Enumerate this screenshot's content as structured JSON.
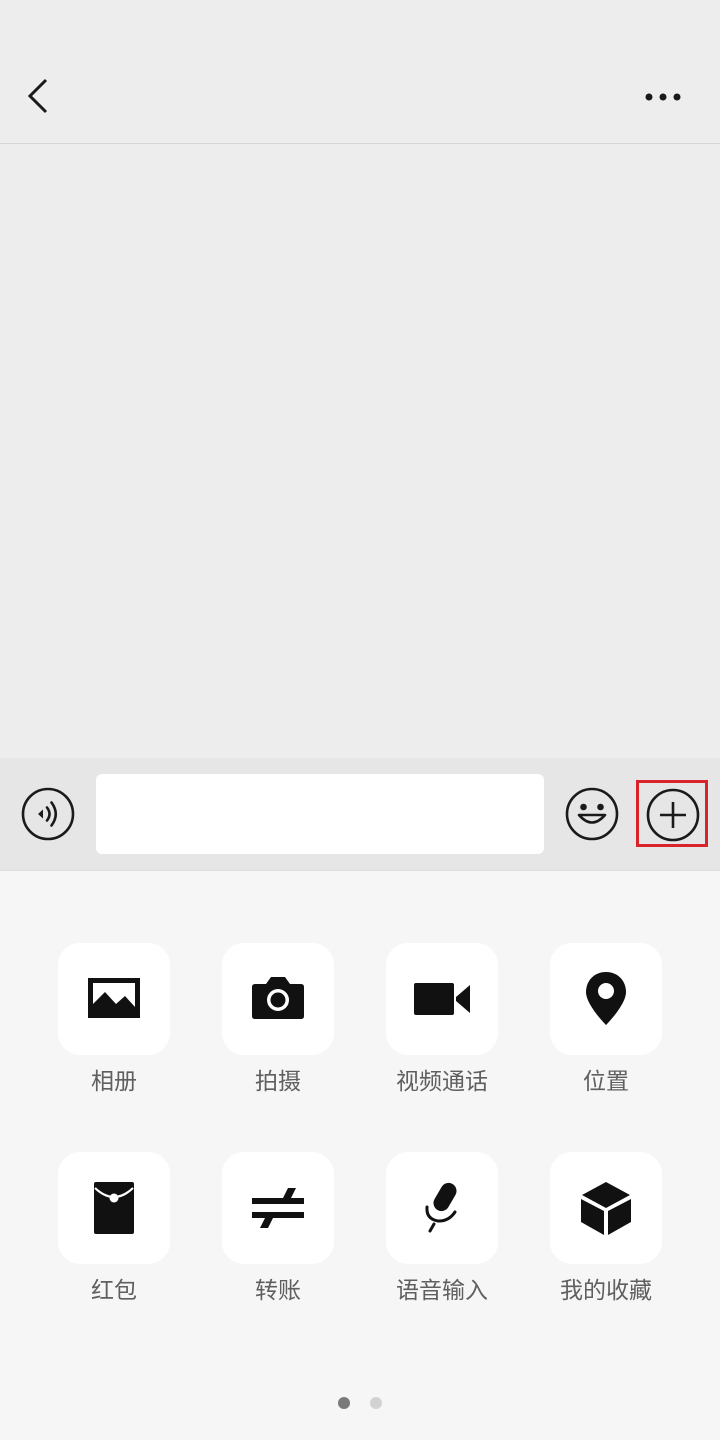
{
  "header": {
    "back_icon": "chevron-left-icon",
    "more_icon": "ellipsis-icon"
  },
  "input_bar": {
    "voice_icon": "voice-input-icon",
    "message_value": "",
    "emoji_icon": "emoji-icon",
    "plus_icon": "plus-circle-icon",
    "highlight_color": "#d8232a"
  },
  "panel": {
    "items": [
      {
        "label": "相册",
        "icon": "photo-album-icon"
      },
      {
        "label": "拍摄",
        "icon": "camera-icon"
      },
      {
        "label": "视频通话",
        "icon": "video-call-icon"
      },
      {
        "label": "位置",
        "icon": "location-pin-icon"
      },
      {
        "label": "红包",
        "icon": "red-envelope-icon"
      },
      {
        "label": "转账",
        "icon": "transfer-icon"
      },
      {
        "label": "语音输入",
        "icon": "microphone-icon"
      },
      {
        "label": "我的收藏",
        "icon": "favorites-box-icon"
      }
    ],
    "page_indicator": {
      "total": 2,
      "current": 1
    }
  }
}
